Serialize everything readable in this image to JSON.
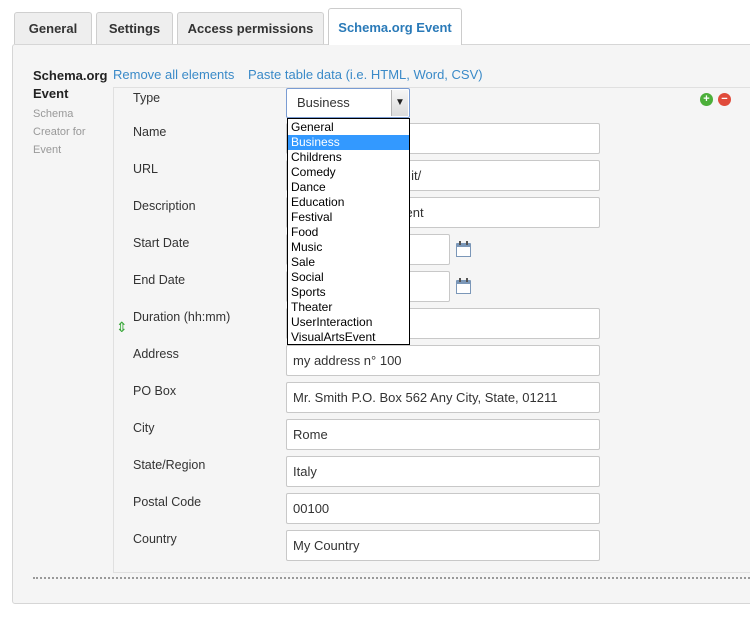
{
  "tabs": [
    {
      "label": "General"
    },
    {
      "label": "Settings"
    },
    {
      "label": "Access permissions"
    },
    {
      "label": "Schema.org Event"
    }
  ],
  "sidebar": {
    "title": "Schema.org Event",
    "description": "Schema Creator for Event"
  },
  "links": {
    "remove_all": "Remove all elements",
    "paste": "Paste table data (i.e. HTML, Word, CSV)"
  },
  "form": {
    "type_label": "Type",
    "type_value": "Business",
    "name_label": "Name",
    "url_label": "URL",
    "url_value": "s.it/",
    "description_label": "Description",
    "description_value": "vent",
    "start_label": "Start Date",
    "end_label": "End Date",
    "duration_label": "Duration (hh:mm)",
    "address_label": "Address",
    "address_value": "my address n° 100",
    "pobox_label": "PO Box",
    "pobox_value": "Mr. Smith P.O. Box 562 Any City, State, 01211",
    "city_label": "City",
    "city_value": "Rome",
    "state_label": "State/Region",
    "state_value": "Italy",
    "postal_label": "Postal Code",
    "postal_value": "00100",
    "country_label": "Country",
    "country_value": "My Country"
  },
  "type_options": [
    "General",
    "Business",
    "Childrens",
    "Comedy",
    "Dance",
    "Education",
    "Festival",
    "Food",
    "Music",
    "Sale",
    "Social",
    "Sports",
    "Theater",
    "UserInteraction",
    "VisualArtsEvent"
  ],
  "selected_option": "Business",
  "icons": {
    "add": "plus-circle-icon",
    "remove": "minus-circle-icon",
    "move": "vertical-arrows-icon",
    "calendar": "calendar-icon"
  },
  "colors": {
    "accent": "#2a7ab8",
    "link": "#3a8ac8",
    "selected_option": "#3399ff",
    "add": "#4caf3a",
    "remove": "#e04b3b"
  }
}
